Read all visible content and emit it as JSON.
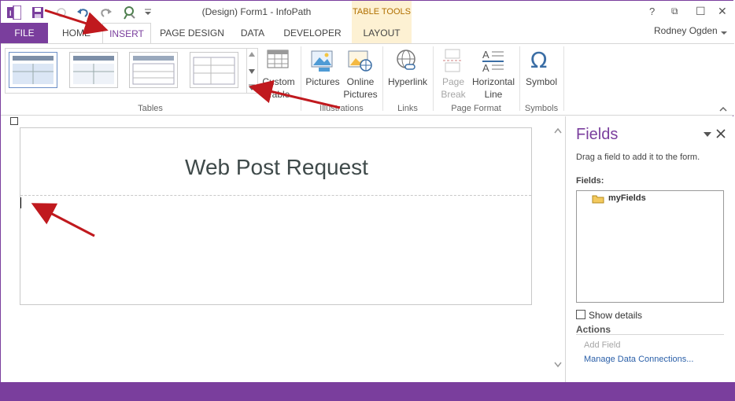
{
  "window": {
    "title": "(Design) Form1 - InfoPath",
    "context_tab_group": "TABLE TOOLS",
    "user": "Rodney Ogden",
    "controls": {
      "help": "?",
      "restore": "⧉",
      "maximize": "☐",
      "close": "✕"
    },
    "colors": {
      "accent": "#7a3e9d",
      "context_tab_bg": "#fdf1d3",
      "context_tab_text": "#b06f00"
    }
  },
  "quick_access": {
    "icons": [
      "infopath-logo-icon",
      "save-icon",
      "undo-icon",
      "undo-icon",
      "redo-icon",
      "form-preview-icon",
      "customize-qat-icon"
    ]
  },
  "tabs": [
    {
      "label": "FILE"
    },
    {
      "label": "HOME"
    },
    {
      "label": "INSERT"
    },
    {
      "label": "PAGE DESIGN"
    },
    {
      "label": "DATA"
    },
    {
      "label": "DEVELOPER"
    },
    {
      "label": "LAYOUT"
    }
  ],
  "ribbon": {
    "groups": {
      "tables": "Tables",
      "illustrations": "Illustrations",
      "links": "Links",
      "page_format": "Page Format",
      "symbols": "Symbols"
    },
    "buttons": {
      "custom_table": "Custom Table",
      "pictures": "Pictures",
      "online_pictures": "Online Pictures",
      "hyperlink": "Hyperlink",
      "page_break": "Page Break",
      "horizontal_line": "Horizontal Line",
      "symbol": "Symbol"
    },
    "symbol_glyph": "Ω"
  },
  "form": {
    "title": "Web Post Request"
  },
  "fields_pane": {
    "title": "Fields",
    "instruction": "Drag a field to add it to the form.",
    "fields_label": "Fields:",
    "tree": [
      {
        "label": "myFields",
        "icon": "folder-icon"
      }
    ],
    "show_details": "Show details",
    "show_details_checked": false,
    "actions_label": "Actions",
    "add_field": "Add Field",
    "manage_connections": "Manage Data Connections..."
  }
}
